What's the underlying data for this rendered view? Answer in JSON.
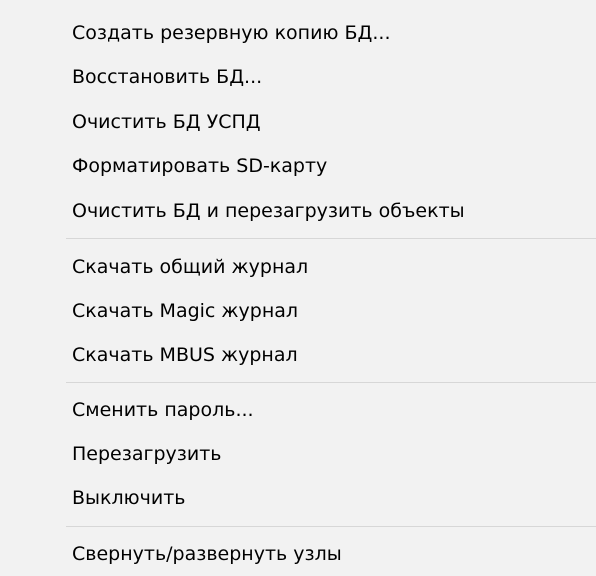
{
  "menu": {
    "groups": [
      {
        "items": [
          {
            "label": "Создать резервную копию БД..."
          },
          {
            "label": "Восстановить БД..."
          },
          {
            "label": "Очистить БД УСПД"
          },
          {
            "label": "Форматировать SD-карту"
          },
          {
            "label": "Очистить БД и перезагрузить объекты"
          }
        ]
      },
      {
        "items": [
          {
            "label": "Скачать общий журнал"
          },
          {
            "label": "Скачать Magic журнал"
          },
          {
            "label": "Скачать MBUS журнал"
          }
        ]
      },
      {
        "items": [
          {
            "label": "Сменить пароль..."
          },
          {
            "label": "Перезагрузить"
          },
          {
            "label": "Выключить"
          }
        ]
      },
      {
        "items": [
          {
            "label": "Свернуть/развернуть узлы"
          }
        ]
      }
    ]
  },
  "colors": {
    "menu_background": "#f2f2f2",
    "separator": "#d7d7d7",
    "text": "#000000"
  }
}
